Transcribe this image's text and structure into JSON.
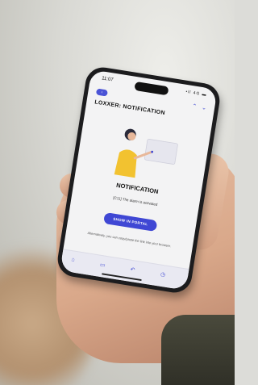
{
  "screen": {
    "time": "11:07",
    "status_icons": "•ll 4G ▬",
    "back_badge": "‹",
    "nav_up": "⌃",
    "nav_down": "⌄",
    "title": "LOXXER: NOTIFICATION",
    "heading": "NOTIFICATION",
    "message": "[C11] The alarm is activated",
    "button_label": "SHOW IN PORTAL",
    "alt_text": "Alternatively, you can copy/paste the link into your browser.",
    "tabs": [
      "⌂",
      "▭",
      "↶",
      "◷"
    ]
  },
  "colors": {
    "accent": "#3f47d4",
    "screen_bg": "#f3f3f4",
    "shirt": "#f2c230"
  }
}
